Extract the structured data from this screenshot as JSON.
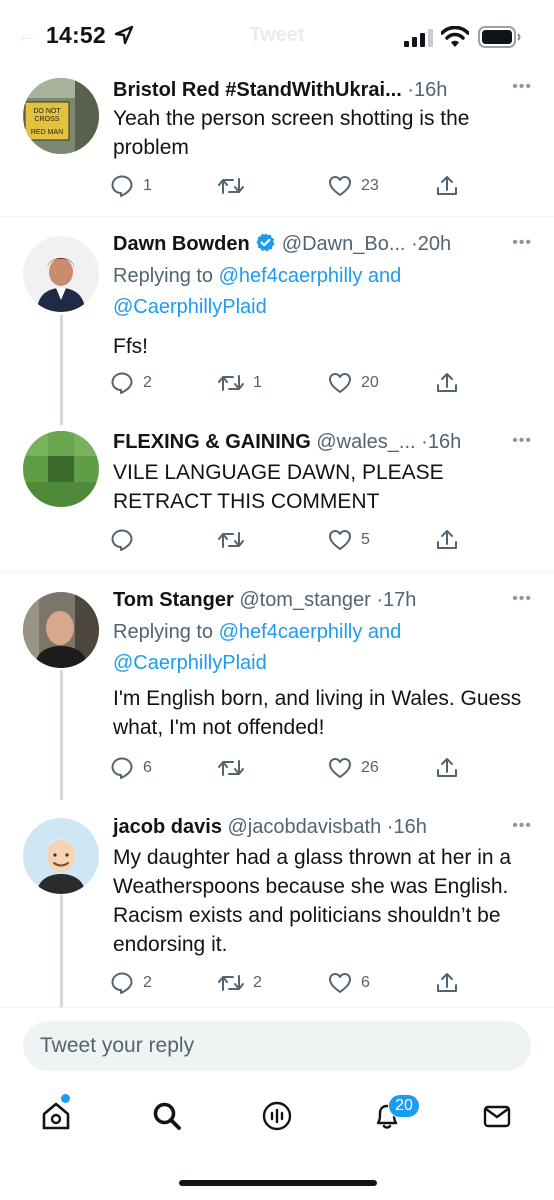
{
  "status_bar": {
    "time": "14:52",
    "faded_title": "Tweet"
  },
  "tweets": [
    {
      "name": "Bristol Red #StandWithUkrai...",
      "handle": "",
      "separator": "·",
      "time": "16h",
      "avatar_text": [
        "DO NOT",
        "CROSS",
        "RED MAN"
      ],
      "body": "Yeah the person screen shotting is the problem",
      "replies": "1",
      "retweets": "",
      "likes": "23"
    },
    {
      "name": "Dawn Bowden",
      "verified": true,
      "handle": "@Dawn_Bo...",
      "separator": "·",
      "time": "20h",
      "replying_label": "Replying to ",
      "replying_1": "@hef4caerphilly",
      "replying_and": " and",
      "replying_2": "@CaerphillyPlaid",
      "body": "Ffs!",
      "replies": "2",
      "retweets": "1",
      "likes": "20"
    },
    {
      "name": "FLEXING & GAINING",
      "handle": "@wales_...",
      "separator": "·",
      "time": "16h",
      "body": "VILE LANGUAGE DAWN, PLEASE RETRACT THIS COMMENT",
      "replies": "",
      "retweets": "",
      "likes": "5"
    },
    {
      "name": "Tom Stanger",
      "handle": "@tom_stanger",
      "separator": "·",
      "time": "17h",
      "replying_label": "Replying to ",
      "replying_1": "@hef4caerphilly",
      "replying_and": " and",
      "replying_2": "@CaerphillyPlaid",
      "body": "I'm English born, and living in Wales. Guess what, I'm not offended!",
      "replies": "6",
      "retweets": "",
      "likes": "26"
    },
    {
      "name": "jacob davis",
      "handle": "@jacobdavisbath",
      "separator": "·",
      "time": "16h",
      "body": "My daughter had a glass thrown at her in a Weatherspoons because she was English. Racism exists and politicians shouldn’t be endorsing it.",
      "replies": "2",
      "retweets": "2",
      "likes": "6"
    }
  ],
  "reply_box": {
    "placeholder": "Tweet your reply"
  },
  "tab_bar": {
    "tabs": [
      "home-icon",
      "search-icon",
      "spaces-icon",
      "notifications-icon",
      "messages-icon"
    ],
    "notifications_badge": "20"
  },
  "colors": {
    "accent": "#1d9bf0",
    "text": "#0f1419",
    "secondary": "#536471",
    "divider": "#eff3f4"
  }
}
